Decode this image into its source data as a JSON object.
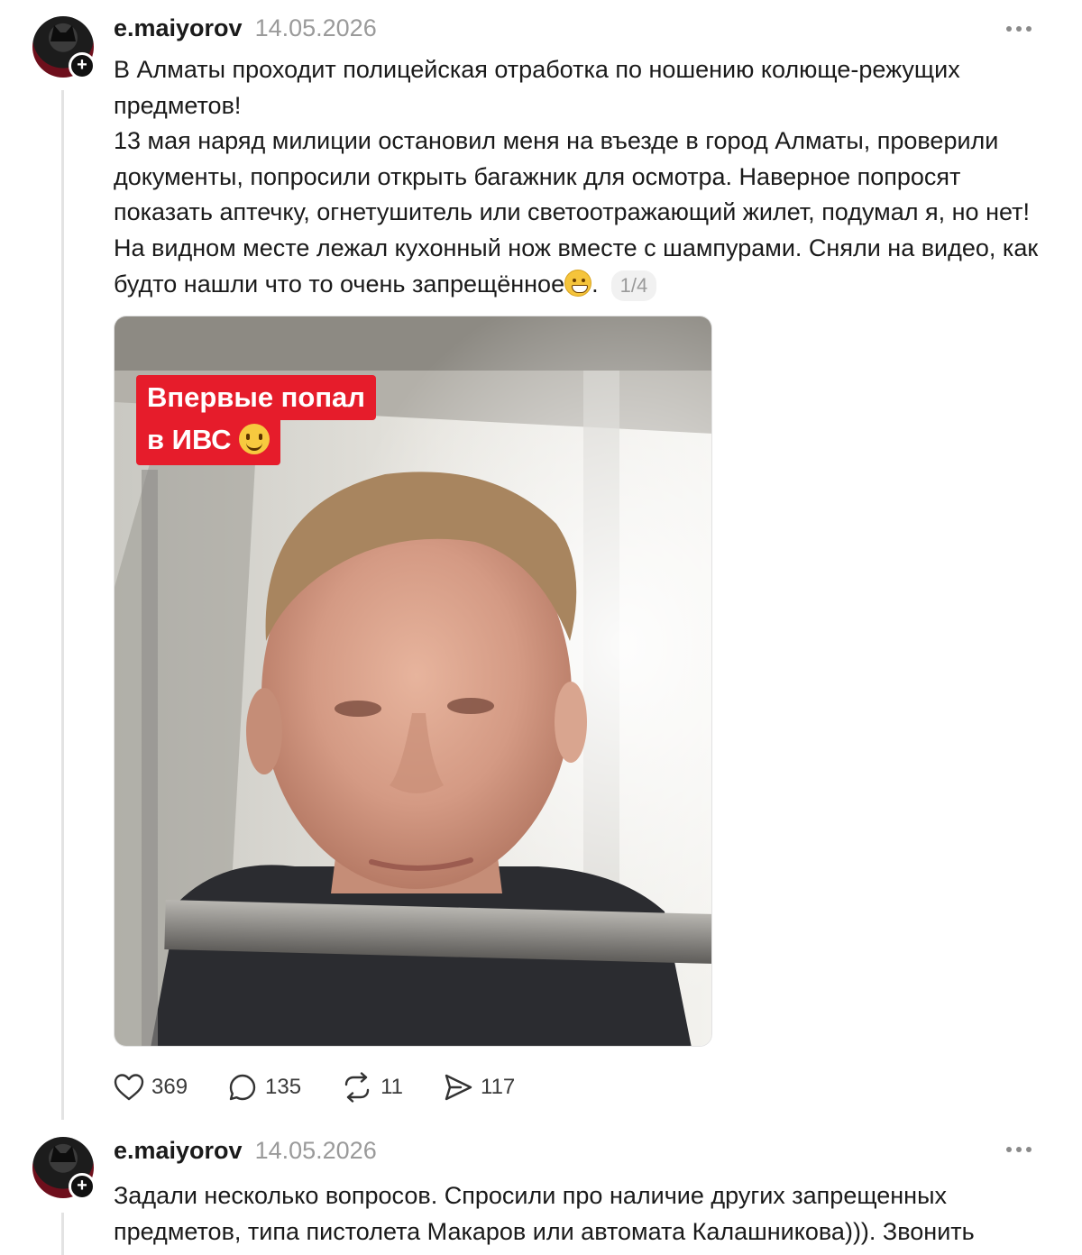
{
  "posts": [
    {
      "author": "e.maiyorov",
      "date": "14.05.2026",
      "paragraphs": [
        "В Алматы проходит полицейская отработка по ношению колюще-режущих предметов!",
        "13 мая наряд милиции остановил меня на въезде в город Алматы, проверили документы, попросили открыть багажник для осмотра. Наверное попросят показать аптечку, огнетушитель или светоотражающий жилет, подумал я, но нет! На видном месте лежал кухонный нож вместе с шампурами. Сняли на видео, как будто нашли что то очень запрещённое"
      ],
      "paragraph_end": ".",
      "media_counter": "1/4",
      "media_caption_line1": "Впервые попал",
      "media_caption_line2": "в ИВС",
      "stats": {
        "likes": "369",
        "comments": "135",
        "reposts": "11",
        "shares": "117"
      }
    },
    {
      "author": "e.maiyorov",
      "date": "14.05.2026",
      "text": "Задали несколько вопросов. Спросили про наличие других запрещенных предметов, типа пистолета Макаров или автомата Калашникова))). Звонить"
    }
  ],
  "icons": {
    "like": "heart-icon",
    "comment": "comment-bubble-icon",
    "repost": "repost-icon",
    "share": "send-icon",
    "more": "more-dots-icon",
    "follow": "plus-badge-icon"
  },
  "colors": {
    "caption_bg": "#e61c2b",
    "muted_text": "#9a9a9a",
    "thread_line": "#e3e3e3"
  }
}
